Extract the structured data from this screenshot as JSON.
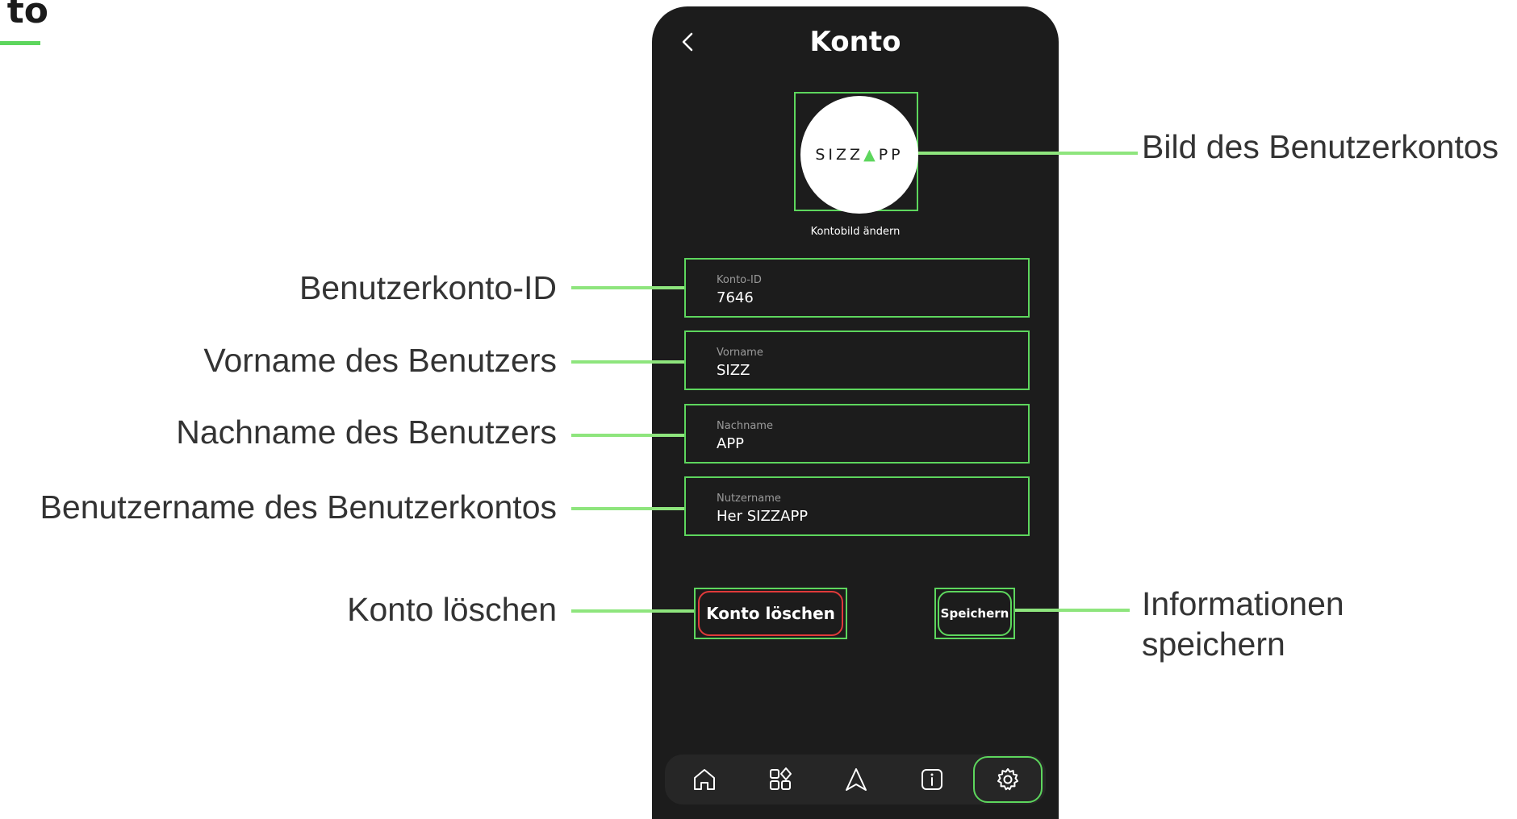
{
  "page": {
    "heading_fragment": "to"
  },
  "screen": {
    "title": "Konto",
    "back_icon": "chevron-left-icon",
    "avatar": {
      "logo_text_left": "SIZZ",
      "logo_text_right": "PP",
      "logo_arrow": "▲",
      "change_label": "Kontobild ändern"
    },
    "fields": [
      {
        "label": "Konto-ID",
        "value": "7646"
      },
      {
        "label": "Vorname",
        "value": "SIZZ"
      },
      {
        "label": "Nachname",
        "value": "APP"
      },
      {
        "label": "Nutzername",
        "value": "Her SIZZAPP"
      }
    ],
    "buttons": {
      "delete": "Konto löschen",
      "save": "Speichern"
    },
    "tabbar": [
      {
        "icon": "home-icon",
        "active": false
      },
      {
        "icon": "apps-grid-icon",
        "active": false
      },
      {
        "icon": "navigation-arrow-icon",
        "active": false
      },
      {
        "icon": "info-icon",
        "active": false
      },
      {
        "icon": "gear-icon",
        "active": true
      }
    ]
  },
  "annotations": {
    "image": "Bild des Benutzerkontos",
    "id": "Benutzerkonto-ID",
    "first_name": "Vorname des Benutzers",
    "last_name": "Nachname des Benutzers",
    "username": "Benutzername des Benutzerkontos",
    "delete": "Konto löschen",
    "save_line1": "Informationen",
    "save_line2": "speichern"
  },
  "colors": {
    "accent": "#5dd65d",
    "danger": "#e03a3a",
    "phone_bg": "#1c1c1c"
  }
}
